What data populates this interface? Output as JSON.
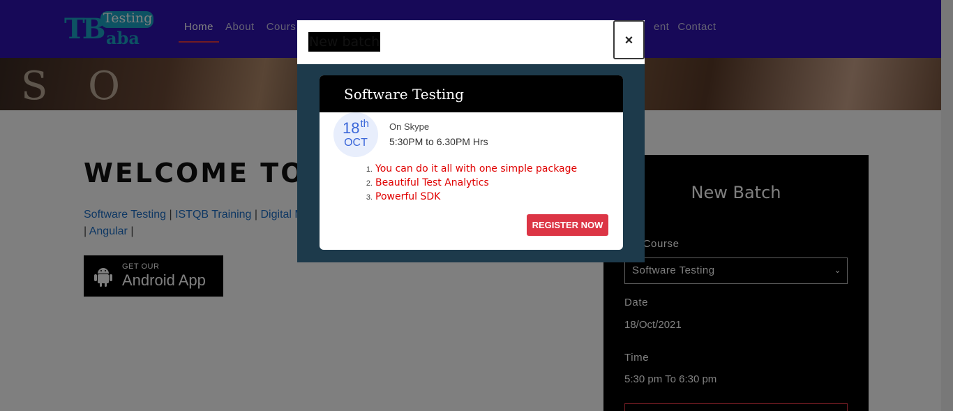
{
  "logo": {
    "tb": "TB",
    "testing": "Testing",
    "aba": "aba"
  },
  "nav": {
    "left": [
      {
        "label": "Home",
        "active": true
      },
      {
        "label": "About"
      },
      {
        "label": "Cours"
      }
    ],
    "right": [
      {
        "label": "ent"
      },
      {
        "label": "Contact"
      }
    ]
  },
  "hero": {
    "letters": "S O"
  },
  "main": {
    "welcome": "WELCOME TO",
    "links": [
      "Software Testing",
      "ISTQB Training",
      "Digital M",
      "Angular"
    ],
    "separator": "|",
    "app_badge": {
      "small": "GET OUR",
      "big": "Android App"
    }
  },
  "batch_panel": {
    "title": "New Batch",
    "course_label": "ect Course",
    "course_value": "Software Testing",
    "date_label": "Date",
    "date_value": "18/Oct/2021",
    "time_label": "Time",
    "time_value": "5:30 pm To 6:30 pm"
  },
  "modal": {
    "title": "New batch",
    "close": "×",
    "card": {
      "title": "Software Testing",
      "day": "18",
      "day_suffix": "th",
      "month": "OCT",
      "venue": "On Skype",
      "time": "5:30PM to 6.30PM Hrs",
      "features": [
        "You can do it all with one simple package",
        "Beautiful Test Analytics",
        "Powerful SDK"
      ],
      "register": "REGISTER NOW"
    }
  },
  "colors": {
    "navbar": "#2e12b0",
    "accent_red": "#dc3545",
    "modal_body": "#1d3a4b",
    "feature_text": "#e00000",
    "date_blue": "#3b67d9"
  }
}
